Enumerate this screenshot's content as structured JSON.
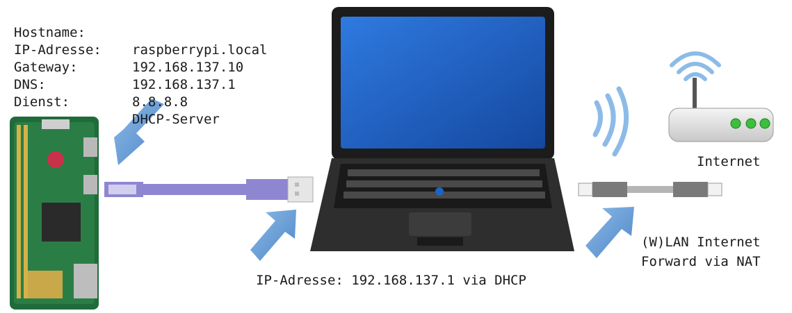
{
  "pi_info": [
    {
      "label": "Hostname:",
      "value": "raspberrypi.local"
    },
    {
      "label": "IP-Adresse:",
      "value": "192.168.137.10"
    },
    {
      "label": "Gateway:",
      "value": "192.168.137.1"
    },
    {
      "label": "DNS:",
      "value": "8.8.8.8"
    },
    {
      "label": "Dienst:",
      "value": "DHCP-Server"
    }
  ],
  "laptop_ip_caption": "IP-Adresse: 192.168.137.1 via DHCP",
  "router_label": "Internet",
  "forward_caption": [
    "(W)LAN Internet",
    "Forward via NAT"
  ],
  "colors": {
    "arrow": "#6a9fd6",
    "usb_cable": "#8f86d1",
    "screen": "#1f63c4",
    "laptop_body": "#2a2a2a",
    "pi_board": "#1f6b3a",
    "router_led": "#3cbf3c"
  },
  "icons": [
    "raspberry-pi-zero-board",
    "usb-cable",
    "laptop",
    "wifi-signal-icon",
    "router",
    "ethernet-cable",
    "arrow-icon"
  ]
}
